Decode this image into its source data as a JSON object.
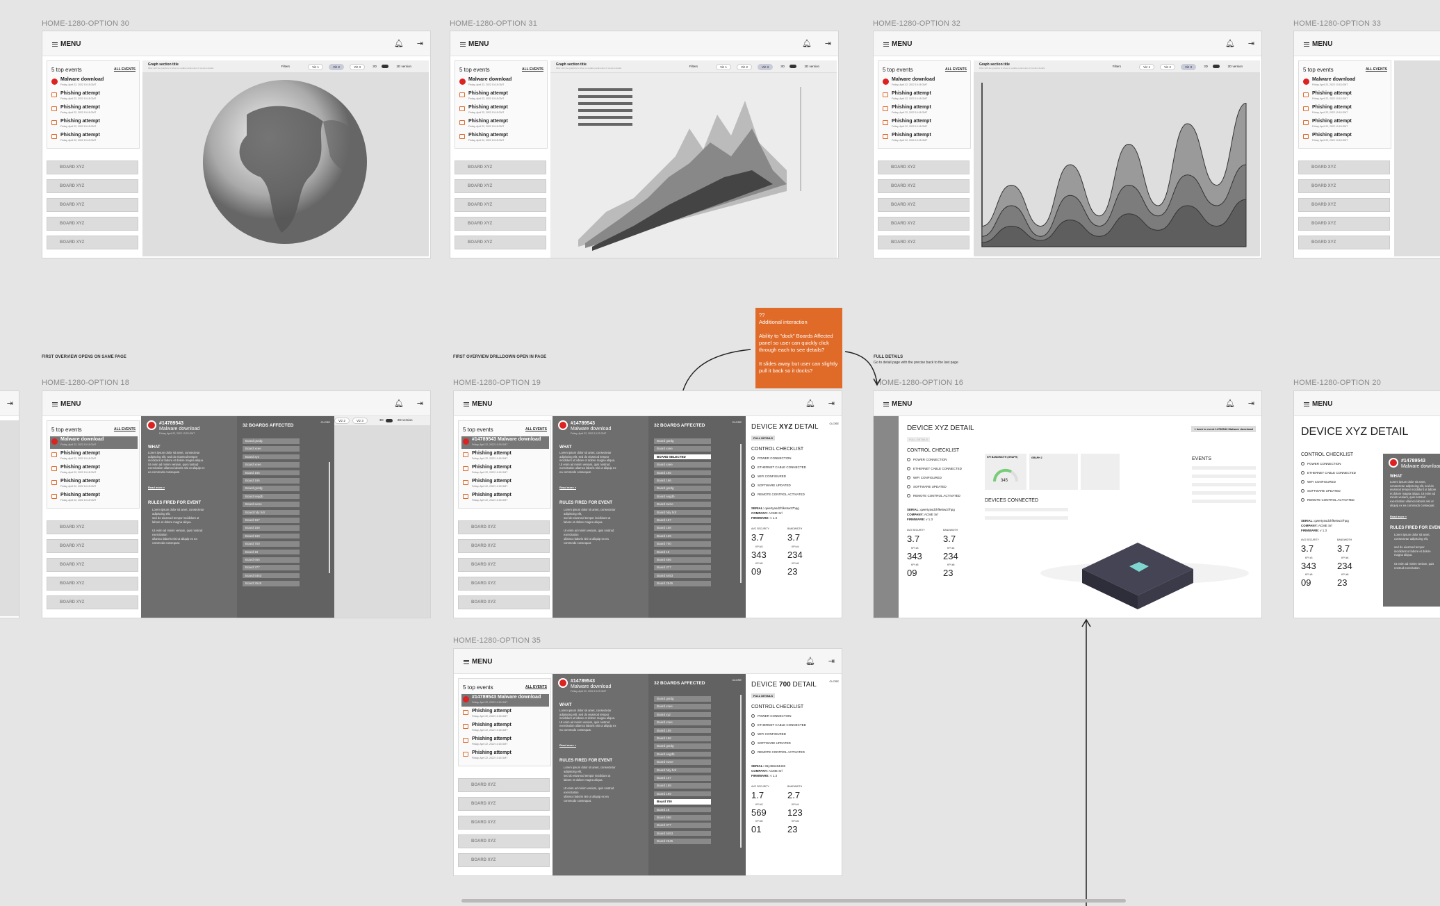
{
  "labels": {
    "opt30": "HOME-1280-OPTION 30",
    "opt31": "HOME-1280-OPTION 31",
    "opt32": "HOME-1280-OPTION 32",
    "opt33": "HOME-1280-OPTION 33",
    "opt18": "HOME-1280-OPTION 18",
    "opt19": "HOME-1280-OPTION 19",
    "opt16": "HOME-1280-OPTION 16",
    "opt20": "HOME-1280-OPTION 20",
    "opt35": "HOME-1280-OPTION 35"
  },
  "notes": {
    "first_overview_same": "FIRST OVERVIEW OPENS ON SAME PAGE",
    "first_overview_drill": "FIRST OVERVIEW DRILLDOWN OPEN IN PAGE",
    "full_details": "FULL DETAILS",
    "full_details_sub": "Go to detail page with the precise back to the last page"
  },
  "sticky": {
    "q": "??",
    "title": "Additional interaction",
    "p1": "Ability to \"dock\" Boards Affected panel so user can quickly click through each to see details?",
    "p2": "It slides away but user can slightly pull it back so it docks?"
  },
  "topbar": {
    "menu": "MENU"
  },
  "events_panel": {
    "title": "5 top events",
    "all": "ALL EVENTS"
  },
  "events": [
    {
      "title": "Malware download",
      "date": "Friday, April 22, 2022 10:18 GMT"
    },
    {
      "title": "Phishing attempt",
      "date": "Friday, April 22, 2022 10:18 GMT"
    },
    {
      "title": "Phishing attempt",
      "date": "Friday, April 22, 2022 10:18 GMT"
    },
    {
      "title": "Phishing attempt",
      "date": "Friday, April 22, 2022 10:18 GMT"
    },
    {
      "title": "Phishing attempt",
      "date": "Friday, April 22, 2022 10:18 GMT"
    }
  ],
  "selected_event": "#14789543 Malware download",
  "board": "BOARD XYZ",
  "viz": {
    "title": "Graph section title",
    "sub": "Filter with the graphics to show or update parameters of content details",
    "filters": "Filters",
    "v1": "Viz 1",
    "v2": "Viz 2",
    "v3": "Viz 3",
    "3d": "3D",
    "2d": "2D version"
  },
  "drill": {
    "id": "#14789543",
    "name": "Malware download",
    "date": "Friday, April 22, 2022 13:23 GMT",
    "what": "WHAT",
    "body": "Lorem ipsum dolor sit amet, consectetur adipiscing elit, sed do eiusmod tempor incididunt ut labore et dolore magna aliqua. Ut enim ad minim veniam, quis nostrud exercitation ullamco laboris nisi ut aliquip ex ea commodo consequat.",
    "read_more": "Read more »",
    "rules": "RULES FIRED FOR EVENT",
    "bullets": [
      "Lorem ipsum dolor sit amet, consectetur adipiscing elit,",
      "sed do eiusmod tempor incididunt ut labore et dolore magna aliqua.",
      "Ut enim ad minim veniam, quis nostrud exercitation",
      "ullamco laboris nisi ut aliquip ex ea commodo consequat."
    ]
  },
  "boards_panel": {
    "title": "32 BOARDS AFFECTED",
    "close": "CLOSE"
  },
  "boards": [
    "Board gsrdg",
    "Board xsee",
    "Board xyz",
    "Board xsee",
    "Board 165",
    "Board 166",
    "Board gsrdg",
    "Board segdb",
    "Board sw1e",
    "Board hdy hdr",
    "Board 167",
    "Board 168",
    "Board 169",
    "Board 700",
    "Board 18",
    "Board 656",
    "Board 377",
    "Board 5453",
    "Board 2545"
  ],
  "boards19": [
    "Board gsrdg",
    "Board xsee",
    "BOARD SELECTED",
    "Board xsee",
    "Board 165",
    "Board 166",
    "Board gsrdg",
    "Board segdb",
    "Board sw1e",
    "Board hdy hdr",
    "Board 167",
    "Board 168",
    "Board 169",
    "Board 700",
    "Board 18",
    "Board 656",
    "Board 377",
    "Board 5453",
    "Board 2545"
  ],
  "detail": {
    "title_pre": "DEVICE ",
    "title_xyz": "XYZ",
    "title_700": "700",
    "title_post": " DETAIL",
    "full_title": "DEVICE XYZ DETAIL",
    "full_details_btn": "FULL DETAILS",
    "close": "CLOSE",
    "control": "CONTROL CHECKLIST",
    "checklist": [
      "POWER CONNECTION",
      "ETHERNET CABLE CONNECTED",
      "WIFI CONFIGURED",
      "SOFTWARE UPDATED",
      "REMOTE CONTROL ACTIVATED"
    ],
    "serial_l": "SERIAL:",
    "serial_v": "qwertyasdzhfke5w37hpg",
    "serial_v700": "36y456484436",
    "company_l": "COMPANY:",
    "company_v": "ACME Srl",
    "firmware_l": "FIRMWARE:",
    "firmware_v": "v 1.3",
    "avg_sec": "AVG SECURITY",
    "bandwidth": "BANDWIDTH",
    "kpi3": "KPI #3",
    "kpi4": "KPI #4",
    "kpi5": "KPI #5",
    "kpi6": "KPI #6",
    "v_xyz": [
      "3.7",
      "3.7",
      "343",
      "234",
      "09",
      "23"
    ],
    "v_700": [
      "1.7",
      "2.7",
      "569",
      "123",
      "01",
      "23"
    ],
    "back": "< back to event 14789543 Malware download",
    "kpi_bw": "KPI BANDWIDTH (GRAPH)",
    "graph2": "GRAPH 2",
    "gauge": "345",
    "devices": "DEVICES CONNECTED",
    "events": "EVENTS"
  },
  "chart_data": {
    "type": "area",
    "title": "Graph section title",
    "series": [
      {
        "values": [
          1,
          3,
          1,
          4,
          1.5,
          5,
          2,
          6,
          3,
          7
        ]
      },
      {
        "values": [
          0.5,
          2,
          0.5,
          2.5,
          1,
          3,
          1.5,
          3.5,
          2,
          4
        ]
      },
      {
        "values": [
          0.2,
          1,
          0.3,
          1.3,
          0.5,
          1.6,
          0.8,
          2,
          1,
          2.3
        ]
      }
    ]
  },
  "colors": {
    "accent": "#e06a28",
    "alert": "#dd2222",
    "drill": "#6e6e6e",
    "selected_viz": "#c7cbdd"
  }
}
